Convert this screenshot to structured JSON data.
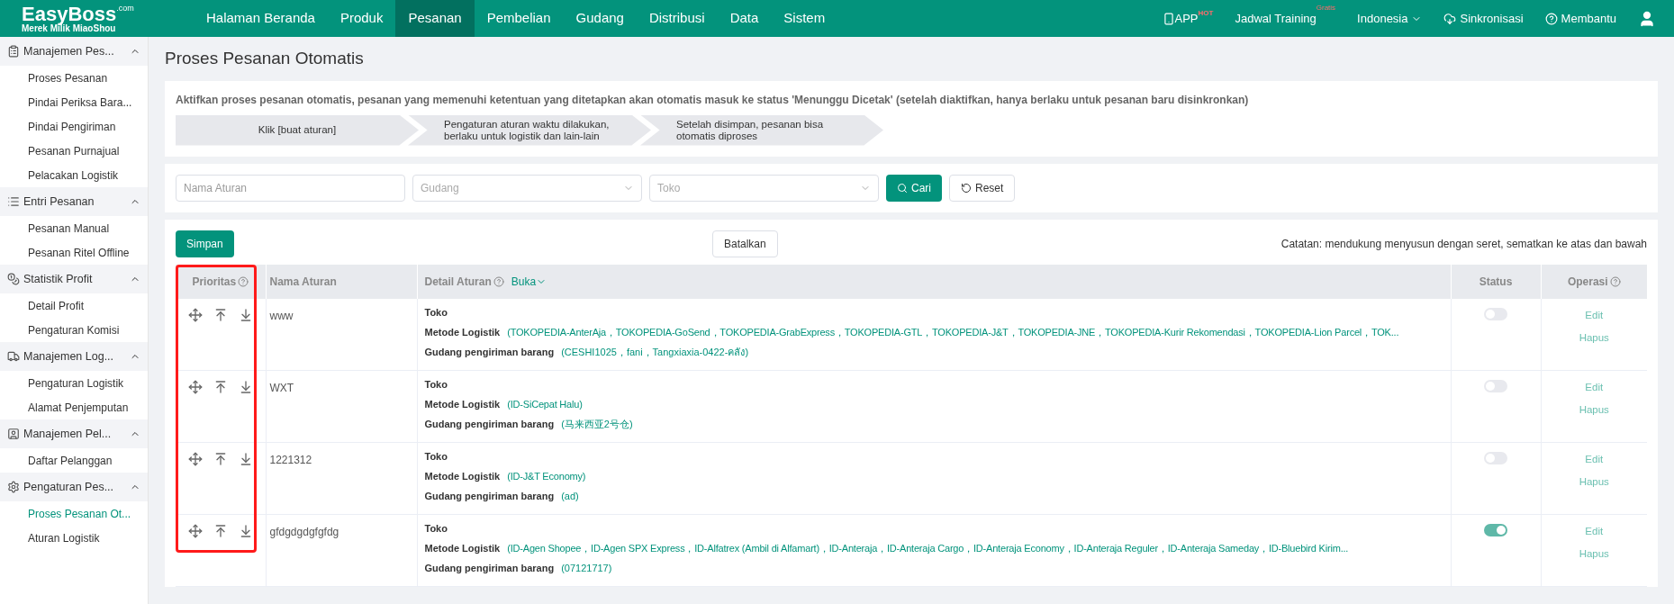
{
  "brand": {
    "name": "EasyBoss",
    "suffix": ".com",
    "tagline": "Merek Milik MiaoShou"
  },
  "nav": [
    {
      "label": "Halaman Beranda",
      "selected": false
    },
    {
      "label": "Produk",
      "selected": false
    },
    {
      "label": "Pesanan",
      "selected": true
    },
    {
      "label": "Pembelian",
      "selected": false
    },
    {
      "label": "Gudang",
      "selected": false
    },
    {
      "label": "Distribusi",
      "selected": false
    },
    {
      "label": "Data",
      "selected": false
    },
    {
      "label": "Sistem",
      "selected": false
    }
  ],
  "top_right": {
    "app": "APP",
    "app_badge": "HOT",
    "training": "Jadwal Training",
    "training_badge": "Gratis",
    "language": "Indonesia",
    "sync": "Sinkronisasi",
    "help": "Membantu"
  },
  "sidebar": [
    {
      "label": "Manajemen Pes...",
      "expanded": true,
      "children": [
        {
          "label": "Proses Pesanan",
          "selected": false
        },
        {
          "label": "Pindai Periksa Bara...",
          "selected": false
        },
        {
          "label": "Pindai Pengiriman",
          "selected": false
        },
        {
          "label": "Pesanan Purnajual",
          "selected": false
        },
        {
          "label": "Pelacakan Logistik",
          "selected": false
        }
      ]
    },
    {
      "label": "Entri Pesanan",
      "expanded": true,
      "children": [
        {
          "label": "Pesanan Manual",
          "selected": false
        },
        {
          "label": "Pesanan Ritel Offline",
          "selected": false
        }
      ]
    },
    {
      "label": "Statistik Profit",
      "expanded": true,
      "children": [
        {
          "label": "Detail Profit",
          "selected": false
        },
        {
          "label": "Pengaturan Komisi",
          "selected": false
        }
      ]
    },
    {
      "label": "Manajemen Log...",
      "expanded": true,
      "children": [
        {
          "label": "Pengaturan Logistik",
          "selected": false
        },
        {
          "label": "Alamat Penjemputan",
          "selected": false
        }
      ]
    },
    {
      "label": "Manajemen Pel...",
      "expanded": true,
      "children": [
        {
          "label": "Daftar Pelanggan",
          "selected": false
        }
      ]
    },
    {
      "label": "Pengaturan Pes...",
      "expanded": true,
      "children": [
        {
          "label": "Proses Pesanan Ot...",
          "selected": true
        },
        {
          "label": "Aturan Logistik",
          "selected": false
        }
      ]
    }
  ],
  "page_title": "Proses Pesanan Otomatis",
  "intro": "Aktifkan proses pesanan otomatis, pesanan yang memenuhi ketentuan yang ditetapkan akan otomatis masuk ke status 'Menunggu Dicetak' (setelah diaktifkan, hanya berlaku untuk pesanan baru disinkronkan)",
  "steps": [
    "Klik [buat aturan]",
    "Pengaturan aturan waktu dilakukan, berlaku untuk logistik dan lain-lain",
    "Setelah disimpan, pesanan bisa otomatis diproses"
  ],
  "filters": {
    "name_placeholder": "Nama Aturan",
    "warehouse_placeholder": "Gudang",
    "store_placeholder": "Toko",
    "search": "Cari",
    "reset": "Reset"
  },
  "actions": {
    "save": "Simpan",
    "cancel": "Batalkan",
    "note": "Catatan: mendukung menyusun dengan seret, sematkan ke atas dan bawah"
  },
  "table": {
    "columns": [
      "Prioritas",
      "Nama Aturan",
      "Detail Aturan",
      "Status",
      "Operasi"
    ],
    "expand_link": "Buka",
    "priority_highlighted": true,
    "rows": [
      {
        "name": "www",
        "store_label": "Toko",
        "logistics_label": "Metode Logistik",
        "logistics": "(TOKOPEDIA-AnterAja，TOKOPEDIA-GoSend，TOKOPEDIA-GrabExpress，TOKOPEDIA-GTL，TOKOPEDIA-J&T，TOKOPEDIA-JNE，TOKOPEDIA-Kurir Rekomendasi，TOKOPEDIA-Lion Parcel，TOK...",
        "warehouse_label": "Gudang pengiriman barang",
        "warehouse": "(CESHI1025，fani，Tangxiaxia-0422-คลัง)",
        "on": false,
        "edit": "Edit",
        "delete": "Hapus"
      },
      {
        "name": "WXT",
        "store_label": "Toko",
        "logistics_label": "Metode Logistik",
        "logistics": "(ID-SiCepat Halu)",
        "warehouse_label": "Gudang pengiriman barang",
        "warehouse": "(马来西亚2号仓)",
        "on": false,
        "edit": "Edit",
        "delete": "Hapus"
      },
      {
        "name": "1221312",
        "store_label": "Toko",
        "logistics_label": "Metode Logistik",
        "logistics": "(ID-J&T Economy)",
        "warehouse_label": "Gudang pengiriman barang",
        "warehouse": "(ad)",
        "on": false,
        "edit": "Edit",
        "delete": "Hapus"
      },
      {
        "name": "gfdgdgdgfgfdg",
        "store_label": "Toko",
        "logistics_label": "Metode Logistik",
        "logistics": "(ID-Agen Shopee，ID-Agen SPX Express，ID-Alfatrex (Ambil di Alfamart)，ID-Anteraja，ID-Anteraja Cargo，ID-Anteraja Economy，ID-Anteraja Reguler，ID-Anteraja Sameday，ID-Bluebird Kirim...",
        "warehouse_label": "Gudang pengiriman barang",
        "warehouse": "(07121717)",
        "on": true,
        "edit": "Edit",
        "delete": "Hapus"
      }
    ]
  }
}
